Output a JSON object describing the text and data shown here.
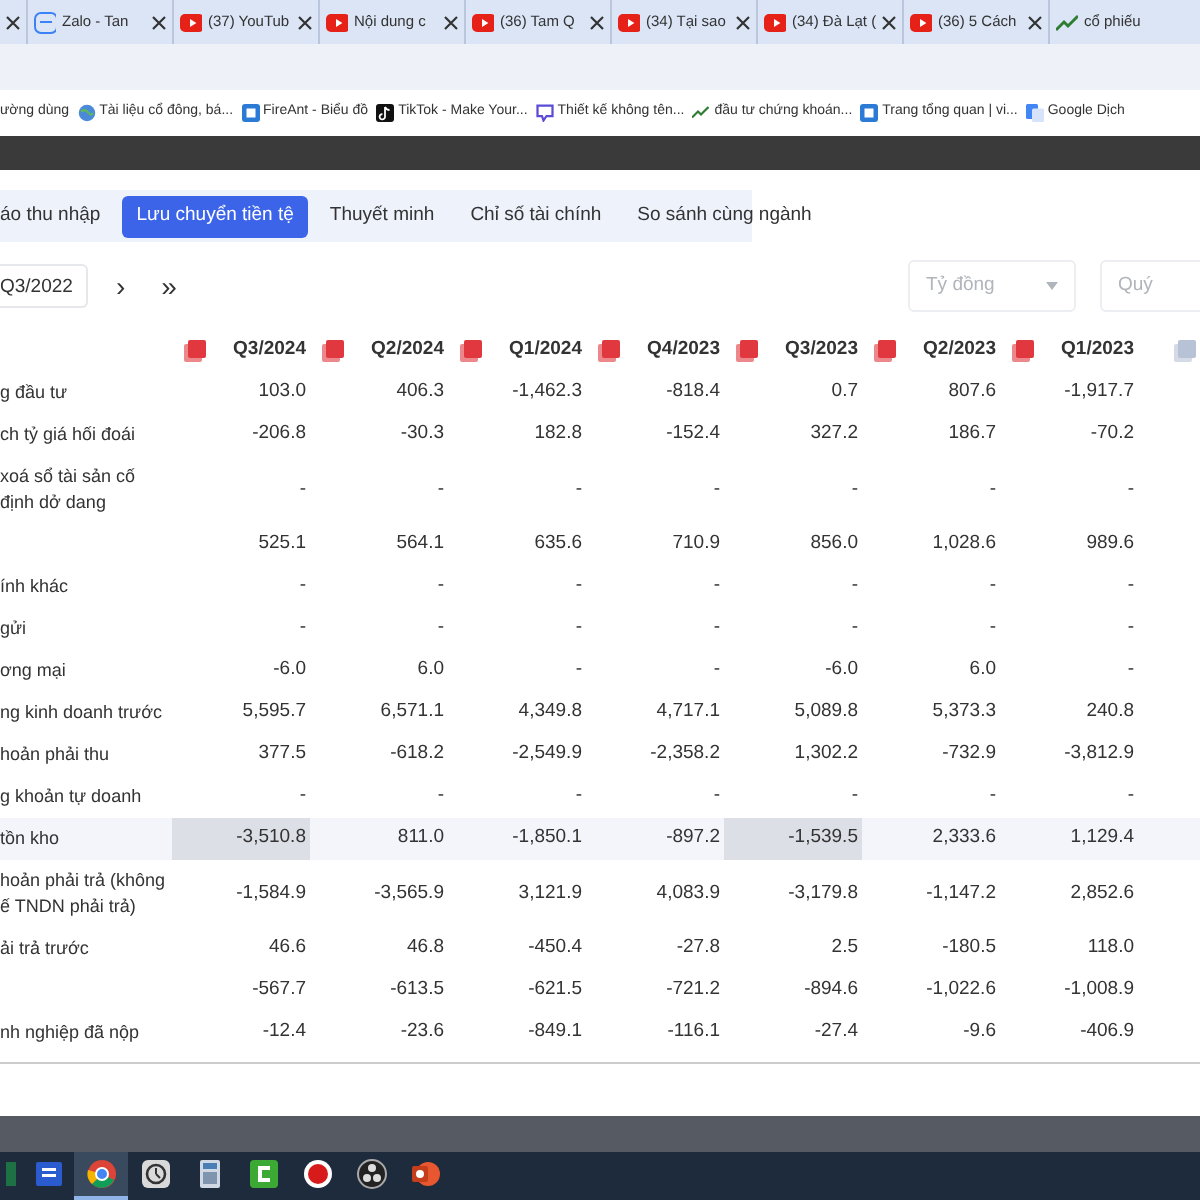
{
  "browser_tabs": [
    {
      "kind": "partial"
    },
    {
      "title": "Zalo - Tan",
      "kind": "zalo"
    },
    {
      "title": "(37) YouTub",
      "kind": "youtube"
    },
    {
      "title": "Nội dung c",
      "kind": "youtube"
    },
    {
      "title": "(36) Tam Q",
      "kind": "youtube"
    },
    {
      "title": "(34) Tại sao",
      "kind": "youtube"
    },
    {
      "title": "(34) Đà Lạt (",
      "kind": "youtube"
    },
    {
      "title": "(36) 5 Cách",
      "kind": "youtube"
    },
    {
      "title": "cổ phiếu",
      "kind": "chart"
    }
  ],
  "bookmarks": [
    {
      "label": "ường dùng",
      "kind": "folder"
    },
    {
      "label": "Tài liệu cổ đông, bá...",
      "kind": "globe"
    },
    {
      "label": "FireAnt - Biểu đồ",
      "kind": "square"
    },
    {
      "label": "TikTok - Make Your...",
      "kind": "tiktok"
    },
    {
      "label": "Thiết kế không tên...",
      "kind": "chat"
    },
    {
      "label": "đầu tư chứng khoán...",
      "kind": "chart"
    },
    {
      "label": "Trang tổng quan | vi...",
      "kind": "square"
    },
    {
      "label": "Google Dịch",
      "kind": "translate"
    }
  ],
  "report_tabs": [
    {
      "label": "áo thu nhập",
      "selected": false
    },
    {
      "label": "Lưu chuyển tiền tệ",
      "selected": true
    },
    {
      "label": "Thuyết minh",
      "selected": false
    },
    {
      "label": "Chỉ số tài chính",
      "selected": false
    },
    {
      "label": "So sánh cùng ngành",
      "selected": false
    }
  ],
  "period_field": {
    "value": "Q3/2022"
  },
  "nav_buttons": [
    {
      "label": "›"
    },
    {
      "label": "»"
    }
  ],
  "unit_select": {
    "value": "Tỷ đồng",
    "disabled": true
  },
  "period_type_select": {
    "value": "Quý",
    "disabled": true
  },
  "table": {
    "columns": [
      {
        "label": "Q3/2024",
        "disabled": false
      },
      {
        "label": "Q2/2024",
        "disabled": false
      },
      {
        "label": "Q1/2024",
        "disabled": false
      },
      {
        "label": "Q4/2023",
        "disabled": false
      },
      {
        "label": "Q3/2023",
        "disabled": false
      },
      {
        "label": "Q2/2023",
        "disabled": false
      },
      {
        "label": "Q1/2023",
        "disabled": false
      },
      {
        "disabled": true
      }
    ],
    "rows": [
      {
        "label": "g đầu tư",
        "highlighted": false,
        "cells": [
          {
            "text": "103.0",
            "selected": false
          },
          {
            "text": "406.3",
            "selected": false
          },
          {
            "text": "-1,462.3",
            "selected": false
          },
          {
            "text": "-818.4",
            "selected": false
          },
          {
            "text": "0.7",
            "selected": false
          },
          {
            "text": "807.6",
            "selected": false
          },
          {
            "text": "-1,917.7",
            "selected": false
          }
        ]
      },
      {
        "label": "ch tỷ giá hối đoái",
        "highlighted": false,
        "cells": [
          {
            "text": "-206.8",
            "selected": false
          },
          {
            "text": "-30.3",
            "selected": false
          },
          {
            "text": "182.8",
            "selected": false
          },
          {
            "text": "-152.4",
            "selected": false
          },
          {
            "text": "327.2",
            "selected": false
          },
          {
            "text": "186.7",
            "selected": false
          },
          {
            "text": "-70.2",
            "selected": false
          }
        ]
      },
      {
        "label": "xoá sổ tài sản cố định dở dang",
        "highlighted": false,
        "cells": [
          {
            "text": "-",
            "selected": false
          },
          {
            "text": "-",
            "selected": false
          },
          {
            "text": "-",
            "selected": false
          },
          {
            "text": "-",
            "selected": false
          },
          {
            "text": "-",
            "selected": false
          },
          {
            "text": "-",
            "selected": false
          },
          {
            "text": "-",
            "selected": false
          }
        ]
      },
      {
        "highlighted": false,
        "cells": [
          {
            "text": "525.1",
            "selected": false
          },
          {
            "text": "564.1",
            "selected": false
          },
          {
            "text": "635.6",
            "selected": false
          },
          {
            "text": "710.9",
            "selected": false
          },
          {
            "text": "856.0",
            "selected": false
          },
          {
            "text": "1,028.6",
            "selected": false
          },
          {
            "text": "989.6",
            "selected": false
          }
        ]
      },
      {
        "label": "ính khác",
        "highlighted": false,
        "cells": [
          {
            "text": "-",
            "selected": false
          },
          {
            "text": "-",
            "selected": false
          },
          {
            "text": "-",
            "selected": false
          },
          {
            "text": "-",
            "selected": false
          },
          {
            "text": "-",
            "selected": false
          },
          {
            "text": "-",
            "selected": false
          },
          {
            "text": "-",
            "selected": false
          }
        ]
      },
      {
        "label": "gửi",
        "highlighted": false,
        "cells": [
          {
            "text": "-",
            "selected": false
          },
          {
            "text": "-",
            "selected": false
          },
          {
            "text": "-",
            "selected": false
          },
          {
            "text": "-",
            "selected": false
          },
          {
            "text": "-",
            "selected": false
          },
          {
            "text": "-",
            "selected": false
          },
          {
            "text": "-",
            "selected": false
          }
        ]
      },
      {
        "label": "ơng mại",
        "highlighted": false,
        "cells": [
          {
            "text": "-6.0",
            "selected": false
          },
          {
            "text": "6.0",
            "selected": false
          },
          {
            "text": "-",
            "selected": false
          },
          {
            "text": "-",
            "selected": false
          },
          {
            "text": "-6.0",
            "selected": false
          },
          {
            "text": "6.0",
            "selected": false
          },
          {
            "text": "-",
            "selected": false
          }
        ]
      },
      {
        "label": "ng kinh doanh trước",
        "highlighted": false,
        "cells": [
          {
            "text": "5,595.7",
            "selected": false
          },
          {
            "text": "6,571.1",
            "selected": false
          },
          {
            "text": "4,349.8",
            "selected": false
          },
          {
            "text": "4,717.1",
            "selected": false
          },
          {
            "text": "5,089.8",
            "selected": false
          },
          {
            "text": "5,373.3",
            "selected": false
          },
          {
            "text": "240.8",
            "selected": false
          }
        ]
      },
      {
        "label": "hoản phải thu",
        "highlighted": false,
        "cells": [
          {
            "text": "377.5",
            "selected": false
          },
          {
            "text": "-618.2",
            "selected": false
          },
          {
            "text": "-2,549.9",
            "selected": false
          },
          {
            "text": "-2,358.2",
            "selected": false
          },
          {
            "text": "1,302.2",
            "selected": false
          },
          {
            "text": "-732.9",
            "selected": false
          },
          {
            "text": "-3,812.9",
            "selected": false
          }
        ]
      },
      {
        "label": "g khoản tự doanh",
        "highlighted": false,
        "cells": [
          {
            "text": "-",
            "selected": false
          },
          {
            "text": "-",
            "selected": false
          },
          {
            "text": "-",
            "selected": false
          },
          {
            "text": "-",
            "selected": false
          },
          {
            "text": "-",
            "selected": false
          },
          {
            "text": "-",
            "selected": false
          },
          {
            "text": "-",
            "selected": false
          }
        ]
      },
      {
        "label": "tồn kho",
        "highlighted": true,
        "cells": [
          {
            "text": "-3,510.8",
            "selected": true
          },
          {
            "text": "811.0",
            "selected": false
          },
          {
            "text": "-1,850.1",
            "selected": false
          },
          {
            "text": "-897.2",
            "selected": false
          },
          {
            "text": "-1,539.5",
            "selected": true
          },
          {
            "text": "2,333.6",
            "selected": false
          },
          {
            "text": "1,129.4",
            "selected": false
          }
        ]
      },
      {
        "label": "hoản phải trả (không ế TNDN phải trả)",
        "highlighted": false,
        "cells": [
          {
            "text": "-1,584.9",
            "selected": false
          },
          {
            "text": "-3,565.9",
            "selected": false
          },
          {
            "text": "3,121.9",
            "selected": false
          },
          {
            "text": "4,083.9",
            "selected": false
          },
          {
            "text": "-3,179.8",
            "selected": false
          },
          {
            "text": "-1,147.2",
            "selected": false
          },
          {
            "text": "2,852.6",
            "selected": false
          }
        ]
      },
      {
        "label": "ải trả trước",
        "highlighted": false,
        "cells": [
          {
            "text": "46.6",
            "selected": false
          },
          {
            "text": "46.8",
            "selected": false
          },
          {
            "text": "-450.4",
            "selected": false
          },
          {
            "text": "-27.8",
            "selected": false
          },
          {
            "text": "2.5",
            "selected": false
          },
          {
            "text": "-180.5",
            "selected": false
          },
          {
            "text": "118.0",
            "selected": false
          }
        ]
      },
      {
        "highlighted": false,
        "cells": [
          {
            "text": "-567.7",
            "selected": false
          },
          {
            "text": "-613.5",
            "selected": false
          },
          {
            "text": "-621.5",
            "selected": false
          },
          {
            "text": "-721.2",
            "selected": false
          },
          {
            "text": "-894.6",
            "selected": false
          },
          {
            "text": "-1,022.6",
            "selected": false
          },
          {
            "text": "-1,008.9",
            "selected": false
          }
        ]
      },
      {
        "label": "nh nghiệp đã nộp",
        "highlighted": false,
        "cells": [
          {
            "text": "-12.4",
            "selected": false
          },
          {
            "text": "-23.6",
            "selected": false
          },
          {
            "text": "-849.1",
            "selected": false
          },
          {
            "text": "-116.1",
            "selected": false
          },
          {
            "text": "-27.4",
            "selected": false
          },
          {
            "text": "-9.6",
            "selected": false
          },
          {
            "text": "-406.9",
            "selected": false
          }
        ]
      }
    ]
  },
  "taskbar": [
    {
      "kind": "excel",
      "active": false
    },
    {
      "kind": "word",
      "active": false
    },
    {
      "kind": "chrome",
      "active": true
    },
    {
      "kind": "clock",
      "active": false
    },
    {
      "kind": "calculator",
      "active": false
    },
    {
      "kind": "camtasia",
      "active": false
    },
    {
      "kind": "record",
      "active": false
    },
    {
      "kind": "obs",
      "active": false
    },
    {
      "kind": "powerpoint",
      "active": false
    }
  ]
}
